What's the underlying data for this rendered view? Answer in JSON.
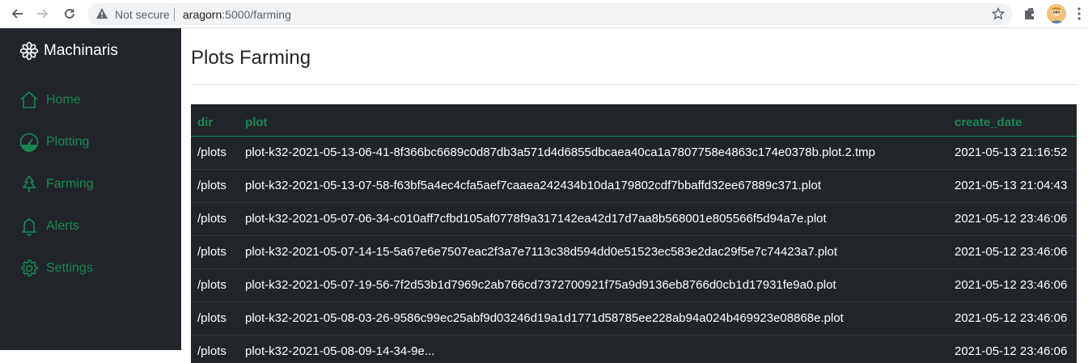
{
  "browser": {
    "security_label": "Not secure",
    "url_host": "aragorn",
    "url_path": ":5000/farming"
  },
  "sidebar": {
    "brand": "Machinaris",
    "items": [
      {
        "label": "Home",
        "icon": "house-icon"
      },
      {
        "label": "Plotting",
        "icon": "speedometer-icon"
      },
      {
        "label": "Farming",
        "icon": "tree-icon"
      },
      {
        "label": "Alerts",
        "icon": "bell-icon"
      },
      {
        "label": "Settings",
        "icon": "gear-icon"
      }
    ]
  },
  "main": {
    "title": "Plots Farming",
    "table": {
      "headers": [
        "dir",
        "plot",
        "create_date"
      ],
      "rows": [
        {
          "dir": "/plots",
          "plot": "plot-k32-2021-05-13-06-41-8f366bc6689c0d87db3a571d4d6855dbcaea40ca1a7807758e4863c174e0378b.plot.2.tmp",
          "create_date": "2021-05-13 21:16:52"
        },
        {
          "dir": "/plots",
          "plot": "plot-k32-2021-05-13-07-58-f63bf5a4ec4cfa5aef7caaea242434b10da179802cdf7bbaffd32ee67889c371.plot",
          "create_date": "2021-05-13 21:04:43"
        },
        {
          "dir": "/plots",
          "plot": "plot-k32-2021-05-07-06-34-c010aff7cfbd105af0778f9a317142ea42d17d7aa8b568001e805566f5d94a7e.plot",
          "create_date": "2021-05-12 23:46:06"
        },
        {
          "dir": "/plots",
          "plot": "plot-k32-2021-05-07-14-15-5a67e6e7507eac2f3a7e7113c38d594dd0e51523ec583e2dac29f5e7c74423a7.plot",
          "create_date": "2021-05-12 23:46:06"
        },
        {
          "dir": "/plots",
          "plot": "plot-k32-2021-05-07-19-56-7f2d53b1d7969c2ab766cd7372700921f75a9d9136eb8766d0cb1d17931fe9a0.plot",
          "create_date": "2021-05-12 23:46:06"
        },
        {
          "dir": "/plots",
          "plot": "plot-k32-2021-05-08-03-26-9586c99ec25abf9d03246d19a1d1771d58785ee228ab94a024b469923e08868e.plot",
          "create_date": "2021-05-12 23:46:06"
        },
        {
          "dir": "/plots",
          "plot": "plot-k32-2021-05-08-09-14-34-9e...",
          "create_date": "2021-05-12 23:46:06"
        }
      ]
    }
  },
  "colors": {
    "sidebar_bg": "#212529",
    "accent_green": "#198754",
    "table_bg": "#212529"
  }
}
